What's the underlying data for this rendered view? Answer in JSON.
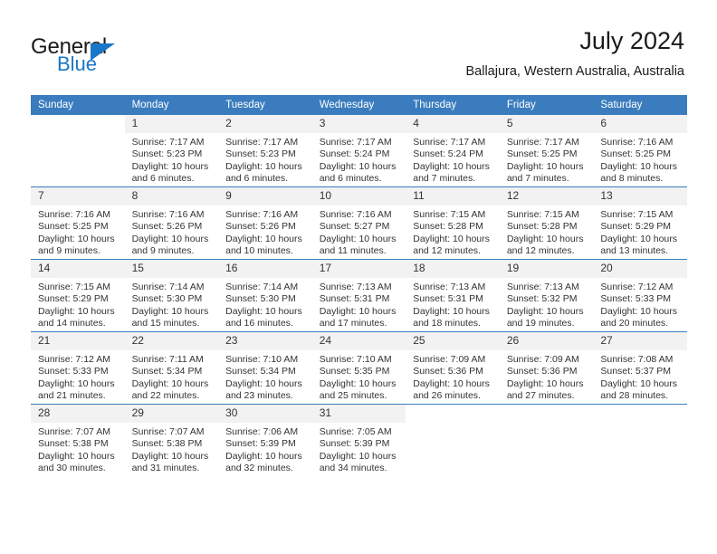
{
  "brand": {
    "word_one": "General",
    "word_two": "Blue",
    "accent_color": "#1a76c6",
    "triangle_icon": "triangle-icon"
  },
  "header": {
    "title": "July 2024",
    "subtitle": "Ballajura, Western Australia, Australia"
  },
  "calendar": {
    "header_bg": "#3a7cbe",
    "daynum_bg": "#f2f2f2",
    "weekdays": [
      "Sunday",
      "Monday",
      "Tuesday",
      "Wednesday",
      "Thursday",
      "Friday",
      "Saturday"
    ],
    "labels": {
      "sunrise": "Sunrise:",
      "sunset": "Sunset:",
      "daylight": "Daylight:"
    },
    "weeks": [
      [
        {
          "blank": true
        },
        {
          "day": "1",
          "sunrise": "Sunrise: 7:17 AM",
          "sunset": "Sunset: 5:23 PM",
          "daylight_line1": "Daylight: 10 hours",
          "daylight_line2": "and 6 minutes."
        },
        {
          "day": "2",
          "sunrise": "Sunrise: 7:17 AM",
          "sunset": "Sunset: 5:23 PM",
          "daylight_line1": "Daylight: 10 hours",
          "daylight_line2": "and 6 minutes."
        },
        {
          "day": "3",
          "sunrise": "Sunrise: 7:17 AM",
          "sunset": "Sunset: 5:24 PM",
          "daylight_line1": "Daylight: 10 hours",
          "daylight_line2": "and 6 minutes."
        },
        {
          "day": "4",
          "sunrise": "Sunrise: 7:17 AM",
          "sunset": "Sunset: 5:24 PM",
          "daylight_line1": "Daylight: 10 hours",
          "daylight_line2": "and 7 minutes."
        },
        {
          "day": "5",
          "sunrise": "Sunrise: 7:17 AM",
          "sunset": "Sunset: 5:25 PM",
          "daylight_line1": "Daylight: 10 hours",
          "daylight_line2": "and 7 minutes."
        },
        {
          "day": "6",
          "sunrise": "Sunrise: 7:16 AM",
          "sunset": "Sunset: 5:25 PM",
          "daylight_line1": "Daylight: 10 hours",
          "daylight_line2": "and 8 minutes."
        }
      ],
      [
        {
          "day": "7",
          "sunrise": "Sunrise: 7:16 AM",
          "sunset": "Sunset: 5:25 PM",
          "daylight_line1": "Daylight: 10 hours",
          "daylight_line2": "and 9 minutes."
        },
        {
          "day": "8",
          "sunrise": "Sunrise: 7:16 AM",
          "sunset": "Sunset: 5:26 PM",
          "daylight_line1": "Daylight: 10 hours",
          "daylight_line2": "and 9 minutes."
        },
        {
          "day": "9",
          "sunrise": "Sunrise: 7:16 AM",
          "sunset": "Sunset: 5:26 PM",
          "daylight_line1": "Daylight: 10 hours",
          "daylight_line2": "and 10 minutes."
        },
        {
          "day": "10",
          "sunrise": "Sunrise: 7:16 AM",
          "sunset": "Sunset: 5:27 PM",
          "daylight_line1": "Daylight: 10 hours",
          "daylight_line2": "and 11 minutes."
        },
        {
          "day": "11",
          "sunrise": "Sunrise: 7:15 AM",
          "sunset": "Sunset: 5:28 PM",
          "daylight_line1": "Daylight: 10 hours",
          "daylight_line2": "and 12 minutes."
        },
        {
          "day": "12",
          "sunrise": "Sunrise: 7:15 AM",
          "sunset": "Sunset: 5:28 PM",
          "daylight_line1": "Daylight: 10 hours",
          "daylight_line2": "and 12 minutes."
        },
        {
          "day": "13",
          "sunrise": "Sunrise: 7:15 AM",
          "sunset": "Sunset: 5:29 PM",
          "daylight_line1": "Daylight: 10 hours",
          "daylight_line2": "and 13 minutes."
        }
      ],
      [
        {
          "day": "14",
          "sunrise": "Sunrise: 7:15 AM",
          "sunset": "Sunset: 5:29 PM",
          "daylight_line1": "Daylight: 10 hours",
          "daylight_line2": "and 14 minutes."
        },
        {
          "day": "15",
          "sunrise": "Sunrise: 7:14 AM",
          "sunset": "Sunset: 5:30 PM",
          "daylight_line1": "Daylight: 10 hours",
          "daylight_line2": "and 15 minutes."
        },
        {
          "day": "16",
          "sunrise": "Sunrise: 7:14 AM",
          "sunset": "Sunset: 5:30 PM",
          "daylight_line1": "Daylight: 10 hours",
          "daylight_line2": "and 16 minutes."
        },
        {
          "day": "17",
          "sunrise": "Sunrise: 7:13 AM",
          "sunset": "Sunset: 5:31 PM",
          "daylight_line1": "Daylight: 10 hours",
          "daylight_line2": "and 17 minutes."
        },
        {
          "day": "18",
          "sunrise": "Sunrise: 7:13 AM",
          "sunset": "Sunset: 5:31 PM",
          "daylight_line1": "Daylight: 10 hours",
          "daylight_line2": "and 18 minutes."
        },
        {
          "day": "19",
          "sunrise": "Sunrise: 7:13 AM",
          "sunset": "Sunset: 5:32 PM",
          "daylight_line1": "Daylight: 10 hours",
          "daylight_line2": "and 19 minutes."
        },
        {
          "day": "20",
          "sunrise": "Sunrise: 7:12 AM",
          "sunset": "Sunset: 5:33 PM",
          "daylight_line1": "Daylight: 10 hours",
          "daylight_line2": "and 20 minutes."
        }
      ],
      [
        {
          "day": "21",
          "sunrise": "Sunrise: 7:12 AM",
          "sunset": "Sunset: 5:33 PM",
          "daylight_line1": "Daylight: 10 hours",
          "daylight_line2": "and 21 minutes."
        },
        {
          "day": "22",
          "sunrise": "Sunrise: 7:11 AM",
          "sunset": "Sunset: 5:34 PM",
          "daylight_line1": "Daylight: 10 hours",
          "daylight_line2": "and 22 minutes."
        },
        {
          "day": "23",
          "sunrise": "Sunrise: 7:10 AM",
          "sunset": "Sunset: 5:34 PM",
          "daylight_line1": "Daylight: 10 hours",
          "daylight_line2": "and 23 minutes."
        },
        {
          "day": "24",
          "sunrise": "Sunrise: 7:10 AM",
          "sunset": "Sunset: 5:35 PM",
          "daylight_line1": "Daylight: 10 hours",
          "daylight_line2": "and 25 minutes."
        },
        {
          "day": "25",
          "sunrise": "Sunrise: 7:09 AM",
          "sunset": "Sunset: 5:36 PM",
          "daylight_line1": "Daylight: 10 hours",
          "daylight_line2": "and 26 minutes."
        },
        {
          "day": "26",
          "sunrise": "Sunrise: 7:09 AM",
          "sunset": "Sunset: 5:36 PM",
          "daylight_line1": "Daylight: 10 hours",
          "daylight_line2": "and 27 minutes."
        },
        {
          "day": "27",
          "sunrise": "Sunrise: 7:08 AM",
          "sunset": "Sunset: 5:37 PM",
          "daylight_line1": "Daylight: 10 hours",
          "daylight_line2": "and 28 minutes."
        }
      ],
      [
        {
          "day": "28",
          "sunrise": "Sunrise: 7:07 AM",
          "sunset": "Sunset: 5:38 PM",
          "daylight_line1": "Daylight: 10 hours",
          "daylight_line2": "and 30 minutes."
        },
        {
          "day": "29",
          "sunrise": "Sunrise: 7:07 AM",
          "sunset": "Sunset: 5:38 PM",
          "daylight_line1": "Daylight: 10 hours",
          "daylight_line2": "and 31 minutes."
        },
        {
          "day": "30",
          "sunrise": "Sunrise: 7:06 AM",
          "sunset": "Sunset: 5:39 PM",
          "daylight_line1": "Daylight: 10 hours",
          "daylight_line2": "and 32 minutes."
        },
        {
          "day": "31",
          "sunrise": "Sunrise: 7:05 AM",
          "sunset": "Sunset: 5:39 PM",
          "daylight_line1": "Daylight: 10 hours",
          "daylight_line2": "and 34 minutes."
        },
        {
          "blank": true
        },
        {
          "blank": true
        },
        {
          "blank": true
        }
      ]
    ]
  }
}
